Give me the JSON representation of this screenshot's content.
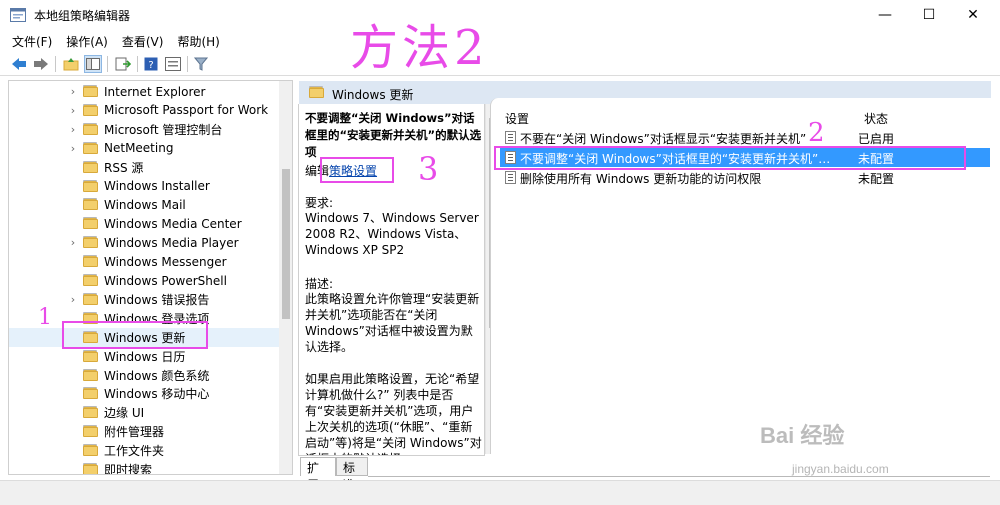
{
  "window": {
    "title": "本地组策略编辑器",
    "minimize": "—",
    "maximize": "☐",
    "close": "✕"
  },
  "menu": [
    "文件(F)",
    "操作(A)",
    "查看(V)",
    "帮助(H)"
  ],
  "tree": {
    "items": [
      {
        "label": "Internet Explorer",
        "expandable": true
      },
      {
        "label": "Microsoft Passport for Work",
        "expandable": true
      },
      {
        "label": "Microsoft 管理控制台",
        "expandable": true
      },
      {
        "label": "NetMeeting",
        "expandable": true
      },
      {
        "label": "RSS 源",
        "expandable": false
      },
      {
        "label": "Windows Installer",
        "expandable": false
      },
      {
        "label": "Windows Mail",
        "expandable": false
      },
      {
        "label": "Windows Media Center",
        "expandable": false
      },
      {
        "label": "Windows Media Player",
        "expandable": true
      },
      {
        "label": "Windows Messenger",
        "expandable": false
      },
      {
        "label": "Windows PowerShell",
        "expandable": false
      },
      {
        "label": "Windows 错误报告",
        "expandable": true
      },
      {
        "label": "Windows 登录选项",
        "expandable": false
      },
      {
        "label": "Windows 更新",
        "expandable": false,
        "selected": true
      },
      {
        "label": "Windows 日历",
        "expandable": false
      },
      {
        "label": "Windows 颜色系统",
        "expandable": false
      },
      {
        "label": "Windows 移动中心",
        "expandable": false
      },
      {
        "label": "边缘 UI",
        "expandable": false
      },
      {
        "label": "附件管理器",
        "expandable": false
      },
      {
        "label": "工作文件夹",
        "expandable": false
      },
      {
        "label": "即时搜索",
        "expandable": false
      }
    ]
  },
  "header": {
    "title": "Windows 更新"
  },
  "description": {
    "title": "不要调整“关闭 Windows”对话框里的“安装更新并关机”的默认选项",
    "edit_prefix": "编辑",
    "edit_link": "策略设置",
    "requirements_label": "要求:",
    "requirements": "Windows 7、Windows Server 2008 R2、Windows Vista、Windows XP SP2",
    "desc_label": "描述:",
    "desc_text": "此策略设置允许你管理“安装更新并关机”选项能否在“关闭 Windows”对话框中被设置为默认选择。",
    "desc_text2": "如果启用此策略设置，无论“希望计算机做什么?” 列表中是否有“安装更新并关机”选项，用户上次关机的选项(“休眠”、“重新启动”等)将是“关闭 Windows”对话框中的默认选择。"
  },
  "list": {
    "col_setting": "设置",
    "col_status": "状态",
    "rows": [
      {
        "name": "不要在“关闭 Windows”对话框显示“安装更新并关机”",
        "state": "已启用",
        "selected": false
      },
      {
        "name": "不要调整“关闭 Windows”对话框里的“安装更新并关机”的默...",
        "state": "未配置",
        "selected": true
      },
      {
        "name": "删除使用所有 Windows 更新功能的访问权限",
        "state": "未配置",
        "selected": false
      }
    ]
  },
  "tabs": [
    "扩展",
    "标准"
  ],
  "annotations": {
    "method": "方法2",
    "n1": "1",
    "n2": "2",
    "n3": "3",
    "color": "#e84be8"
  },
  "watermark": {
    "logo": "Bai 经验",
    "url": "jingyan.baidu.com"
  }
}
